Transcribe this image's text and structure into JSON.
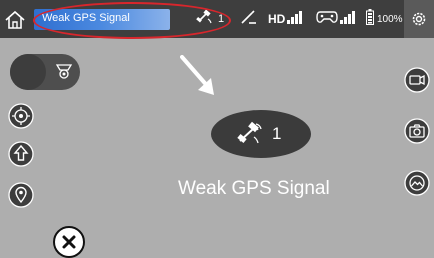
{
  "topbar": {
    "status_message": "Weak GPS Signal",
    "satellite_count": "1",
    "video_label": "HD",
    "battery_percent": "100%"
  },
  "main": {
    "satellite_count": "1",
    "warning_text": "Weak GPS Signal"
  },
  "icons": {
    "home": "home-icon",
    "satellite": "satellite-icon",
    "drone_signal": "drone-signal-icon",
    "hd_signal": "signal-bars-icon",
    "controller": "controller-icon",
    "battery": "battery-icon",
    "settings": "gear-icon",
    "camera_mode": "camera-mode-icon",
    "orbit": "orbit-icon",
    "takeoff": "takeoff-icon",
    "location": "location-icon",
    "record": "video-record-icon",
    "photo": "photo-camera-icon",
    "gallery": "gallery-icon",
    "close": "close-icon"
  },
  "colors": {
    "alert_ring": "#d8262c",
    "status_gradient_start": "#2f6fd0",
    "status_gradient_end": "#8bb2ea",
    "panel": "#3e3e3e"
  }
}
